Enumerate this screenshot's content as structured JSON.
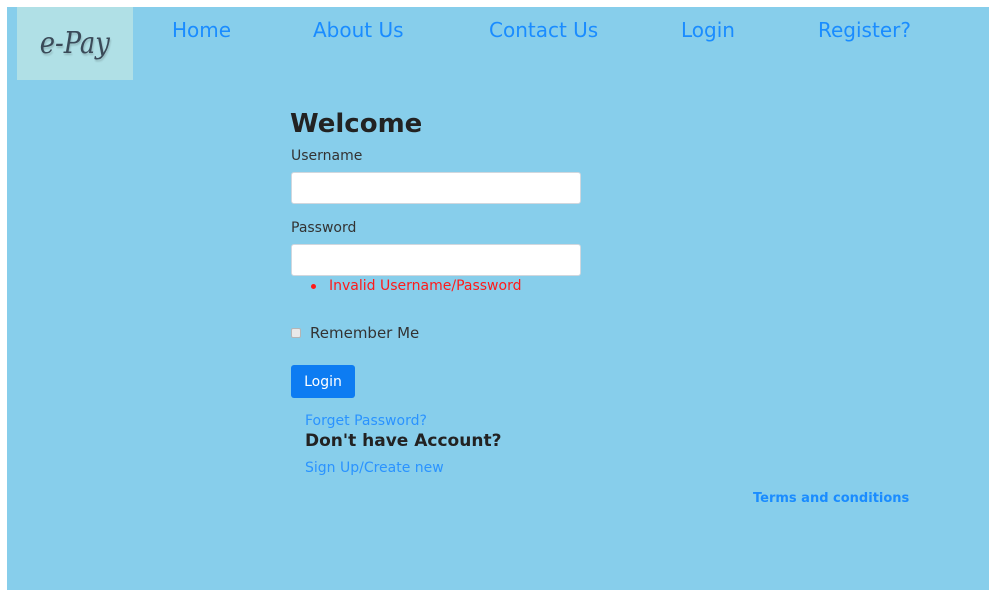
{
  "logo": {
    "text": "e-Pay"
  },
  "nav": {
    "home": "Home",
    "about": "About Us",
    "contact": "Contact Us",
    "login": "Login",
    "register": "Register?"
  },
  "form": {
    "title": "Welcome",
    "username_label": "Username",
    "username_value": "",
    "password_label": "Password",
    "password_value": "",
    "error": "Invalid Username/Password",
    "remember_label": "Remember Me",
    "remember_checked": false,
    "submit_label": "Login",
    "forgot_link": "Forget Password?",
    "no_account_heading": "Don't have Account?",
    "signup_link": "Sign Up/Create new"
  },
  "footer": {
    "terms": "Terms and conditions"
  },
  "colors": {
    "background": "#87ceeb",
    "logo_bg": "#b0e0e6",
    "link": "#1a8cff",
    "button": "#0d7cf2",
    "error": "#ff1a1a"
  }
}
